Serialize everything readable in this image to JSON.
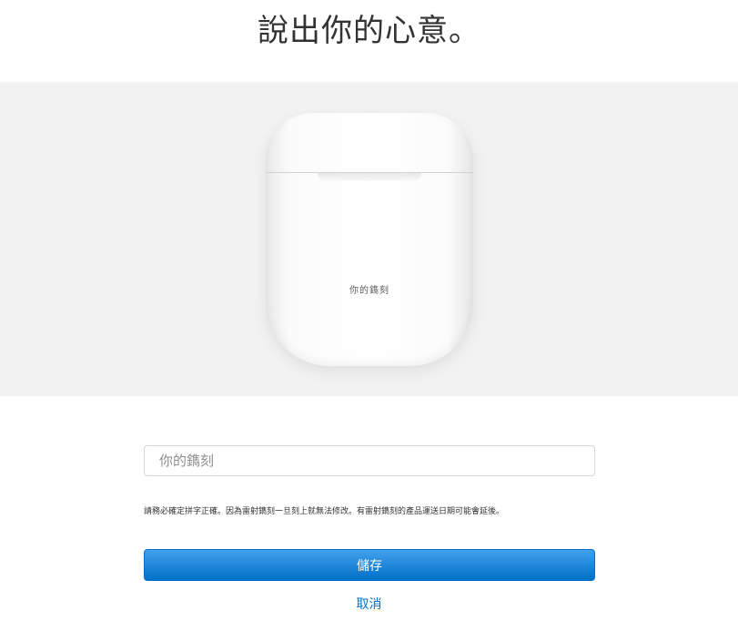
{
  "header": {
    "title": "說出你的心意。"
  },
  "preview": {
    "engraving_text": "你的鐫刻"
  },
  "form": {
    "engraving_placeholder": "你的鐫刻",
    "notice": "請務必確定拼字正確。因為雷射鐫刻一旦刻上就無法修改。有雷射鐫刻的產品運送日期可能會延後。",
    "save_label": "儲存",
    "cancel_label": "取消"
  },
  "colors": {
    "accent": "#0070c9",
    "band_background": "#f2f2f2"
  }
}
